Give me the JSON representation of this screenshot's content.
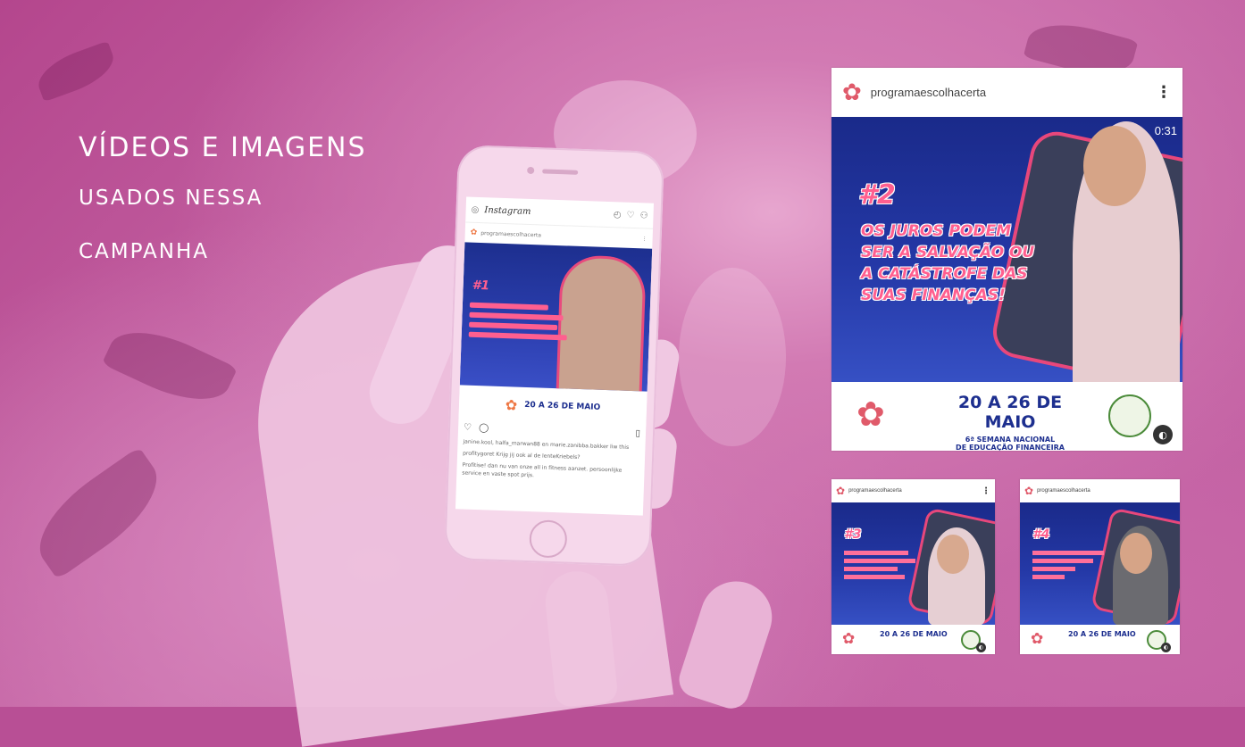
{
  "heading": {
    "line1": "VÍDEOS E IMAGENS",
    "line2": "USADOS NESSA",
    "line3": "CAMPANHA"
  },
  "phone": {
    "app_name": "Instagram",
    "account": "programaescolhacerta",
    "post_tag": "#1",
    "date": "20 A 26 DE MAIO",
    "comment1": "janine.kool, halfa_marwan88 en marie.zanibba.bakker liw this",
    "comment2": "profitygoret Krijg jij ook al de lenteKriebels?",
    "comment3": "Profitise! dan nu van onze all in fitness aanzet. persoonlijke service en vaste spot prijs."
  },
  "main_card": {
    "account": "programaescolhacerta",
    "counter": "0:31",
    "tag": "#2",
    "headline_1": "OS JUROS PODEM",
    "headline_2": "SER A SALVAÇÃO OU",
    "headline_3": "A CATÁSTROFE DAS",
    "headline_4": "SUAS FINANÇAS!",
    "date": "20 A 26 DE MAIO",
    "sub1": "6ª SEMANA NACIONAL",
    "sub2": "DE EDUCAÇÃO FINANCEIRA"
  },
  "card3": {
    "account": "programaescolhacerta",
    "tag": "#3",
    "date": "20 A 26 DE MAIO"
  },
  "card4": {
    "account": "programaescolhacerta",
    "tag": "#4",
    "date": "20 A 26 DE MAIO"
  },
  "colors": {
    "background": "#b84f95",
    "video_blue": "#1d2f8f",
    "accent_pink": "#ff5f8f"
  }
}
